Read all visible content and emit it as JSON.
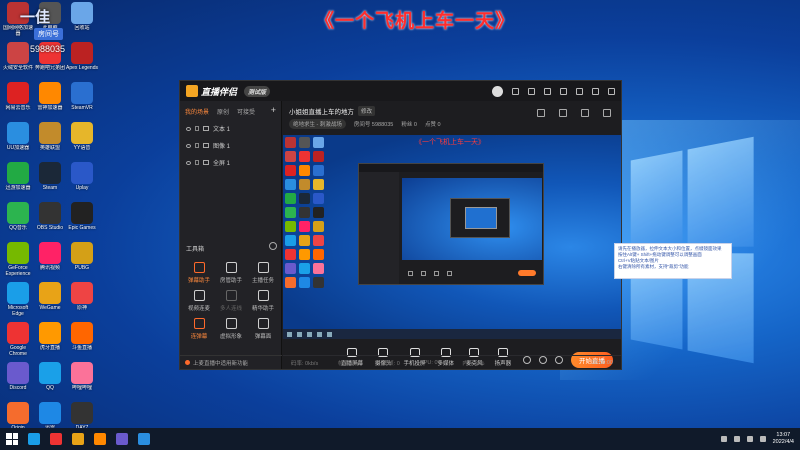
{
  "overlay": {
    "stream_title": "《一个飞机上车一天》",
    "anchor_name": "一佳",
    "badge": "房间号",
    "room_id": "5988035"
  },
  "desktop_icons": [
    {
      "label": "国网网络加速器",
      "color": "#b33"
    },
    {
      "label": "此电脑",
      "color": "#555"
    },
    {
      "label": "回收站",
      "color": "#6aa6e8"
    },
    {
      "label": "火绒安全软件",
      "color": "#c44"
    },
    {
      "label": "奔跑吧兄弟团",
      "color": "#e33"
    },
    {
      "label": "Apex Legends",
      "color": "#b22"
    },
    {
      "label": "网易云音乐",
      "color": "#d22"
    },
    {
      "label": "雷神加速器",
      "color": "#f80"
    },
    {
      "label": "SteamVR",
      "color": "#2a6fd0"
    },
    {
      "label": "UU加速器",
      "color": "#2a8ee0"
    },
    {
      "label": "英雄联盟",
      "color": "#c28b2b"
    },
    {
      "label": "YY语音",
      "color": "#e6b62a"
    },
    {
      "label": "迅游加速器",
      "color": "#2a4"
    },
    {
      "label": "Steam",
      "color": "#1b2838"
    },
    {
      "label": "Uplay",
      "color": "#2a58c8"
    },
    {
      "label": "QQ音乐",
      "color": "#2cb44f"
    },
    {
      "label": "OBS Studio",
      "color": "#333"
    },
    {
      "label": "Epic Games",
      "color": "#222"
    },
    {
      "label": "GeForce Experience",
      "color": "#76b900"
    },
    {
      "label": "腾讯视频",
      "color": "#f26"
    },
    {
      "label": "PUBG",
      "color": "#d4a017"
    },
    {
      "label": "Microsoft Edge",
      "color": "#1a9ee8"
    },
    {
      "label": "WeGame",
      "color": "#e8a317"
    },
    {
      "label": "原神",
      "color": "#e44"
    },
    {
      "label": "Google Chrome",
      "color": "#e33"
    },
    {
      "label": "虎牙直播",
      "color": "#f90"
    },
    {
      "label": "斗鱼直播",
      "color": "#f60"
    },
    {
      "label": "Discord",
      "color": "#6a5acd"
    },
    {
      "label": "QQ",
      "color": "#1aa0e8"
    },
    {
      "label": "哔哩哔哩",
      "color": "#fb7299"
    },
    {
      "label": "Origin",
      "color": "#f56c2d"
    },
    {
      "label": "迅雷",
      "color": "#1e88e5"
    },
    {
      "label": "DAY7",
      "color": "#333"
    }
  ],
  "app": {
    "brand": "直播伴侣",
    "version": "测试版",
    "tabs": [
      "我的场景",
      "原创",
      "可接受"
    ],
    "sources": [
      "文本 1",
      "图像 1",
      "全屏 1"
    ],
    "tools_title": "工具箱",
    "tools": [
      {
        "label": "弹幕助手",
        "hot": true,
        "dim": false
      },
      {
        "label": "房管助手",
        "hot": false,
        "dim": false
      },
      {
        "label": "主播任务",
        "hot": false,
        "dim": false
      },
      {
        "label": "视频连麦",
        "hot": false,
        "dim": false
      },
      {
        "label": "多人连线",
        "hot": false,
        "dim": true
      },
      {
        "label": "精华助手",
        "hot": false,
        "dim": false
      },
      {
        "label": "连弹幕",
        "hot": true,
        "dim": false
      },
      {
        "label": "虚拟形象",
        "hot": false,
        "dim": false
      },
      {
        "label": "弹幕面",
        "hot": false,
        "dim": false
      }
    ],
    "bottom_status": "上麦直播中适用新功能",
    "room_title": "小姐姐直播上车的地方",
    "edit_label": "修改",
    "category": "绝地求生 - 刺激战场",
    "room_meta": [
      "房间号 5988035",
      "粉丝 0",
      "点赞 0"
    ],
    "preview_caption": "《一个飞机上车一天》",
    "controls": [
      "直播屏幕",
      "摄像头",
      "手机投屏",
      "多媒体",
      "麦克风",
      "扬声器"
    ],
    "go_live": "开始直播",
    "stats": [
      "码率: 0kb/s",
      "帧率: 0fps",
      "丢帧: 0",
      "CPU: 0%",
      "内存: 0%"
    ],
    "timer": "00:00:00"
  },
  "hint_lines": [
    "请先在播放器，拉伸文本大小和位置，点缀镜面效果",
    "按住Alt键+ Shift+拖动键调整可以调整画面",
    "Ctrl+V粘贴文本/图片",
    "右键清除所有素材，支持“裁剪”功能"
  ],
  "taskbar": {
    "apps": [
      "#1a9ee8",
      "#e33",
      "#e8a317",
      "#f80",
      "#6a5acd",
      "#2a8ee0"
    ],
    "time": "13:07",
    "date": "2022/4/4"
  }
}
